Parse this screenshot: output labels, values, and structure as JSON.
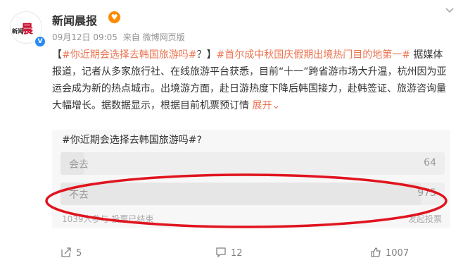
{
  "user": {
    "name": "新闻晨报",
    "logo_text": "晨",
    "logo_small": "新闻",
    "verified_mark": "V",
    "fan_badge": "♥"
  },
  "meta": {
    "time": "09月12日 09:05",
    "source": "来自 微博网页版"
  },
  "post": {
    "bracket_open": "【",
    "tag1": "#你近期会选择去韩国旅游吗#",
    "bracket_mid": "？】",
    "tag2": "#首尔成中秋国庆假期出境热门目的地第一#",
    "body": " 据媒体报道，记者从多家旅行社、在线旅游平台获悉，目前“十一”跨省游市场大升温，杭州因为亚运会成为新的热点城市。出境游方面，赴日游热度下降后韩国接力，赴韩签证、旅游咨询量大幅增长。据数据显示，根据目前机票预订情",
    "expand_label": "展开"
  },
  "vote": {
    "title": "#你近期会选择去韩国旅游吗#?",
    "options": [
      {
        "label": "会去",
        "count": "64",
        "fraction": 0.062
      },
      {
        "label": "不去",
        "count": "975",
        "fraction": 0.938
      }
    ],
    "footer": "1039人参与 投票已结束",
    "create_label": "发起投票"
  },
  "actions": {
    "share": "5",
    "comment": "12",
    "like": "1007"
  },
  "colors": {
    "accent": "#eb7350",
    "highlight_ellipse": "#e0141e",
    "verified": "#2a8bef"
  }
}
